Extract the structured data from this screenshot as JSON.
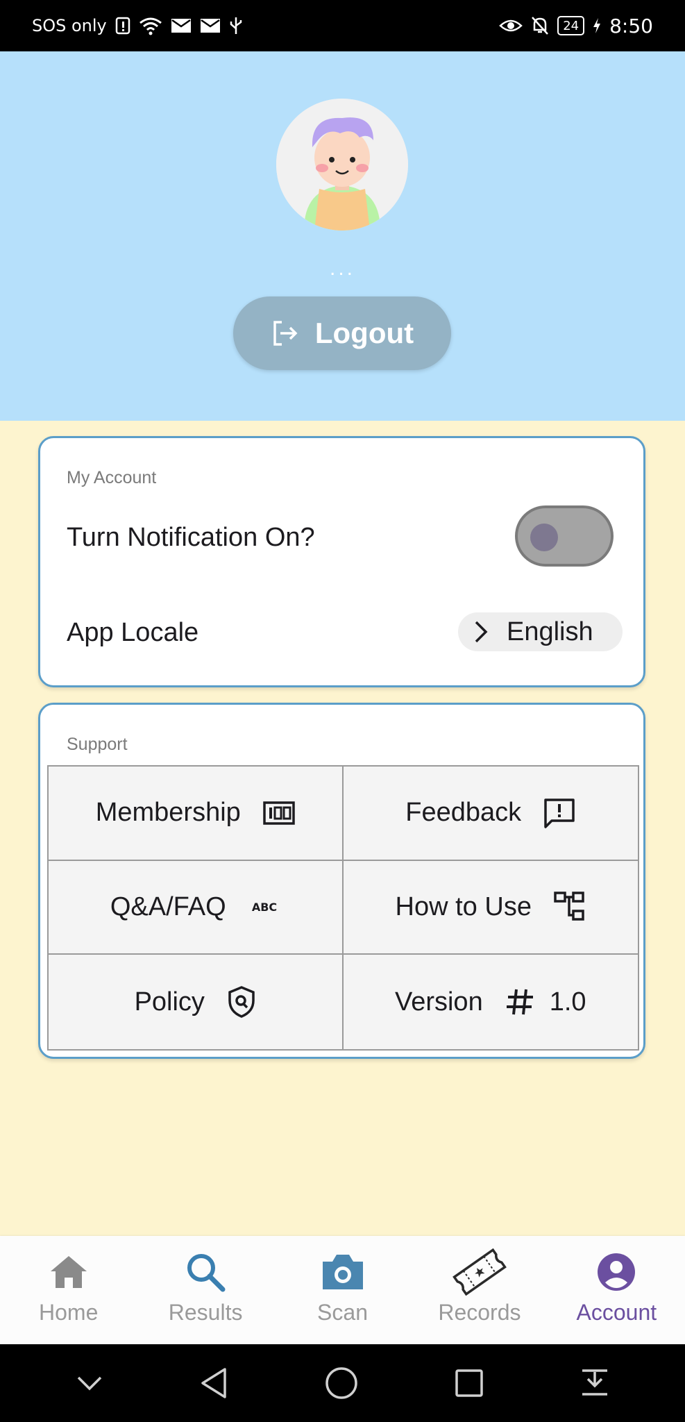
{
  "status_bar": {
    "carrier": "SOS only",
    "battery": "24",
    "time": "8:50"
  },
  "header": {
    "user_name": "...",
    "logout_label": "Logout"
  },
  "account_card": {
    "title": "My Account",
    "notification_label": "Turn Notification On?",
    "notification_on": false,
    "locale_label": "App Locale",
    "locale_value": "English"
  },
  "support_card": {
    "title": "Support",
    "items": [
      {
        "label": "Membership",
        "icon": "membership-icon"
      },
      {
        "label": "Feedback",
        "icon": "feedback-icon"
      },
      {
        "label": "Q&A/FAQ",
        "icon": "abc-icon"
      },
      {
        "label": "How to Use",
        "icon": "account-tree-icon"
      },
      {
        "label": "Policy",
        "icon": "policy-shield-icon"
      },
      {
        "label": "Version",
        "icon": "hash-icon",
        "value": "1.0"
      }
    ]
  },
  "bottom_nav": {
    "items": [
      {
        "label": "Home",
        "icon": "home-icon"
      },
      {
        "label": "Results",
        "icon": "search-icon"
      },
      {
        "label": "Scan",
        "icon": "camera-icon"
      },
      {
        "label": "Records",
        "icon": "ticket-icon"
      },
      {
        "label": "Account",
        "icon": "account-circle-icon",
        "active": true
      }
    ]
  },
  "colors": {
    "header_bg": "#b6e0fb",
    "page_bg": "#fdf4cf",
    "card_border": "#5b9ec9",
    "active_nav": "#6b4fa0"
  }
}
